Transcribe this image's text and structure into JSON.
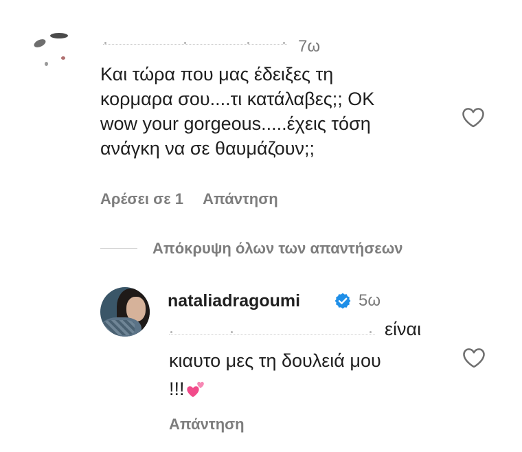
{
  "comments": [
    {
      "time": "7ω",
      "text_lines": [
        "Και τώρα που μας έδειξες τη",
        "κορμαρα σου....τι κατάλαβες;; ΟΚ",
        "wow your gorgeous.....έχεις τόση",
        "ανάγκη να σε θαυμάζουν;;"
      ],
      "likes": "Αρέσει σε 1",
      "reply_label": "Απάντηση",
      "like_icon": "heart-outline-icon"
    }
  ],
  "hide_replies": "Απόκρυψη όλων των απαντήσεων",
  "reply": {
    "username": "nataliadragoumi",
    "verified_icon": "verified-badge-icon",
    "time": "5ω",
    "line1": "είναι",
    "line2": "κιαυτο μες τη δουλειά μου",
    "line3": "!!!",
    "emoji": "two-hearts-emoji",
    "reply_label": "Απάντηση",
    "like_icon": "heart-outline-icon"
  },
  "colors": {
    "text": "#1f1f1f",
    "muted": "#7d7d7d",
    "verified": "#1f8fe8",
    "emoji_pink": "#f14b8a"
  }
}
